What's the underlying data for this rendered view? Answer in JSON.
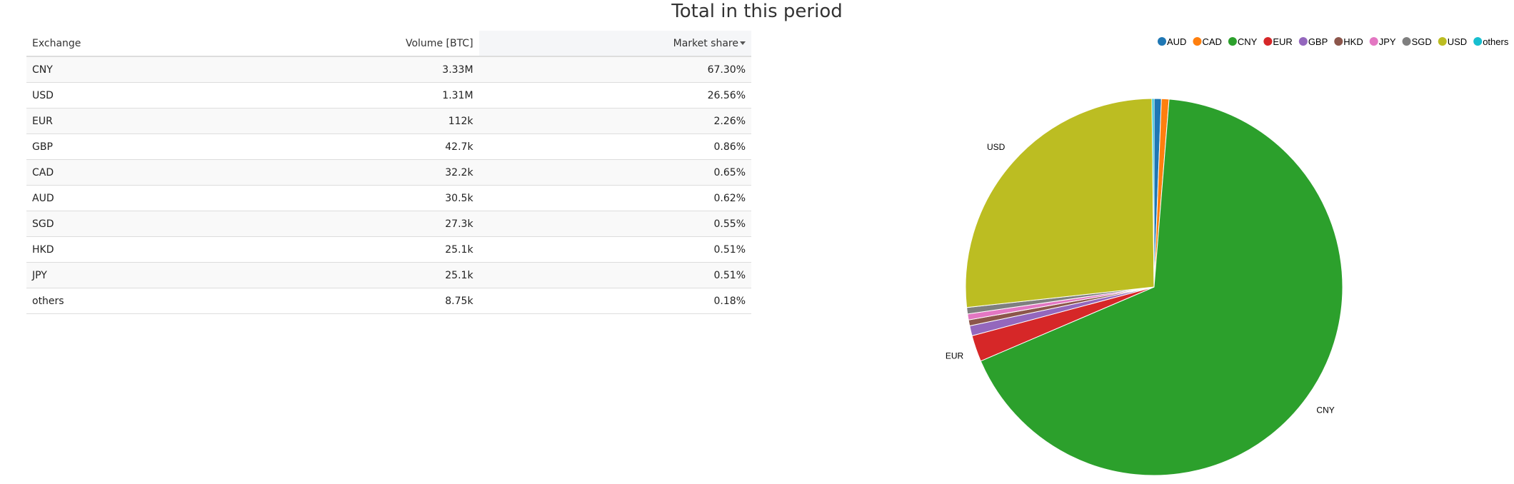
{
  "title": "Total in this period",
  "table": {
    "headers": [
      "Exchange",
      "Volume [BTC]",
      "Market share"
    ],
    "sorted_column": "Market share",
    "rows": [
      [
        "CNY",
        "3.33M",
        "67.30%"
      ],
      [
        "USD",
        "1.31M",
        "26.56%"
      ],
      [
        "EUR",
        "112k",
        "2.26%"
      ],
      [
        "GBP",
        "42.7k",
        "0.86%"
      ],
      [
        "CAD",
        "32.2k",
        "0.65%"
      ],
      [
        "AUD",
        "30.5k",
        "0.62%"
      ],
      [
        "SGD",
        "27.3k",
        "0.55%"
      ],
      [
        "HKD",
        "25.1k",
        "0.51%"
      ],
      [
        "JPY",
        "25.1k",
        "0.51%"
      ],
      [
        "others",
        "8.75k",
        "0.18%"
      ]
    ]
  },
  "chart_data": {
    "type": "pie",
    "legend_position": "top-right",
    "categories": [
      "AUD",
      "CAD",
      "CNY",
      "EUR",
      "GBP",
      "HKD",
      "JPY",
      "SGD",
      "USD",
      "others"
    ],
    "values": [
      0.62,
      0.65,
      67.3,
      2.26,
      0.86,
      0.51,
      0.51,
      0.55,
      26.56,
      0.18
    ],
    "colors": [
      "#1f77b4",
      "#ff7f0e",
      "#2ca02c",
      "#d62728",
      "#9467bd",
      "#8c564b",
      "#e377c2",
      "#7f7f7f",
      "#bcbd22",
      "#17becf"
    ],
    "slice_labels": [
      "CNY",
      "USD",
      "EUR"
    ]
  }
}
